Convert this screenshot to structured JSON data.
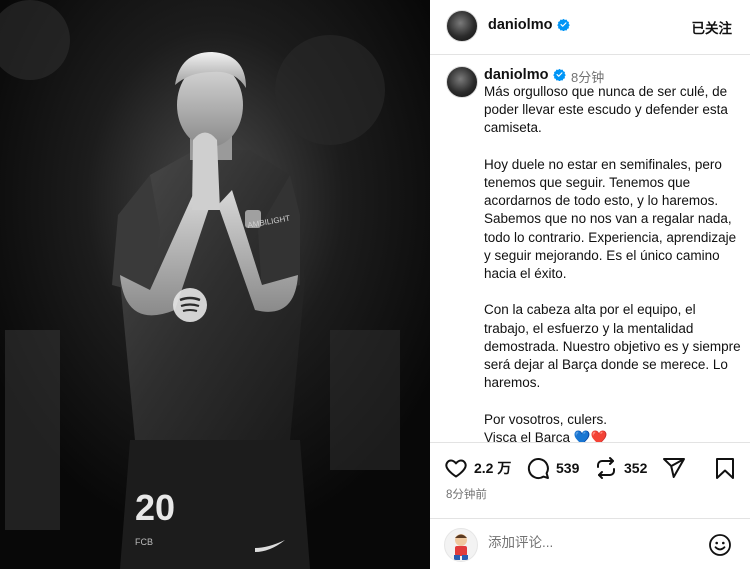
{
  "photo": {
    "alt_subject": "player-photo",
    "jersey_number": "20",
    "jersey_text": "AMBILIGHT",
    "club_crest_text": "FCB"
  },
  "header": {
    "username": "daniolmo",
    "verified_icon": "verified-badge-icon",
    "follow_label": "已关注",
    "more_icon": "more-icon"
  },
  "post": {
    "username": "daniolmo",
    "time_ago": "8分钟",
    "caption_paragraphs": [
      "Más orgulloso que nunca de ser culé, de poder llevar este escudo y defender esta camiseta.",
      "Hoy duele no estar en semifinales, pero tenemos que seguir. Tenemos que acordarnos de todo esto, y lo haremos. Sabemos que no nos van a regalar nada, todo lo contrario. Experiencia, aprendizaje y seguir mejorando. Es el único camino hacia el éxito.",
      "Con la cabeza alta por el equipo, el trabajo, el esfuerzo y la mentalidad demostrada. Nuestro objetivo es y siempre será dejar al Barça donde se merece. Lo haremos."
    ],
    "closing_line1": "Por vosotros, culers.",
    "closing_line2": "Visca el Barça ",
    "closing_hearts": "💙❤️"
  },
  "actions": {
    "likes": "2.2 万",
    "comments": "539",
    "reposts": "352",
    "like_icon": "heart-icon",
    "comment_icon": "comment-icon",
    "repost_icon": "repost-icon",
    "share_icon": "share-icon",
    "save_icon": "bookmark-icon"
  },
  "timestamp": "8分钟前",
  "comment_box": {
    "placeholder": "添加评论...",
    "emoji_icon": "emoji-icon"
  },
  "colors": {
    "verified": "#0095f6",
    "muted_text": "#737373",
    "divider": "#e3e3e3"
  }
}
